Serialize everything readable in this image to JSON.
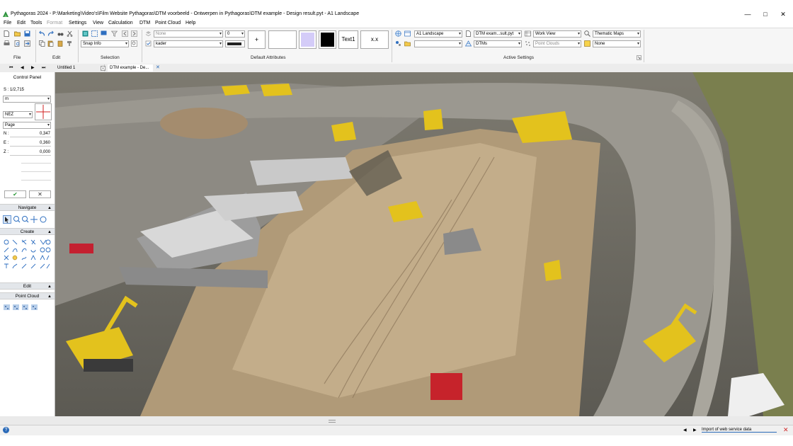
{
  "window": {
    "title": "Pythagoras 2024 - P:\\Marketing\\Video's\\Film Website Pythagoras\\DTM voorbeeld - Ontwerpen in Pythagoras\\DTM example - Design result.pyt - A1 Landscape",
    "minimize": "—",
    "maximize": "□",
    "close": "✕"
  },
  "menu": [
    "File",
    "Edit",
    "Tools",
    "Format",
    "Settings",
    "View",
    "Calculation",
    "DTM",
    "Point Cloud",
    "Help"
  ],
  "ribbon": {
    "groups": {
      "file": "File",
      "edit": "Edit",
      "selection": "Selection",
      "default_attributes": "Default Attributes",
      "active_settings": "Active Settings"
    },
    "snap": "Snap Info",
    "layer_top": "None",
    "layer_bottom": "kader",
    "line_number": "0",
    "plus": "+",
    "text_sample": "Text1",
    "coord_sample": "x.x",
    "active": {
      "layout": "A1 Landscape",
      "dtm_file": "DTM exam...sult.pyt",
      "view": "Work View",
      "thematic": "Thematic Maps",
      "blank": "",
      "dtms": "DTMs",
      "point_clouds": "Point Clouds",
      "thematic_value": "None"
    },
    "colors": {
      "fill_swatch": "#d4ccf8",
      "black_swatch": "#000000",
      "accent": "#2a6ab8"
    }
  },
  "tabs": {
    "nav_first": "⏮",
    "nav_prev": "◀",
    "nav_next": "▶",
    "nav_last": "⏭",
    "items": [
      {
        "label": "Untitled 1",
        "active": false
      },
      {
        "label": "DTM example - De...",
        "active": true
      }
    ],
    "close": "✕"
  },
  "control_panel": {
    "title": "Control Panel",
    "scale": "S : 1/2,715",
    "unit": "m",
    "coord_system": "NEZ",
    "reference": "Page",
    "n_label": "N :",
    "n_value": "0,347",
    "e_label": "E :",
    "e_value": "0,360",
    "z_label": "Z :",
    "z_value": "0,000",
    "ok": "✔",
    "cancel": "✕",
    "sections": {
      "navigate": "Navigate",
      "create": "Create",
      "edit": "Edit",
      "point_cloud": "Point Cloud"
    }
  },
  "statusbar": {
    "help": "?",
    "import_text": "Import of web service data",
    "prev": "◀",
    "next": "▶",
    "cancel": "✕"
  }
}
